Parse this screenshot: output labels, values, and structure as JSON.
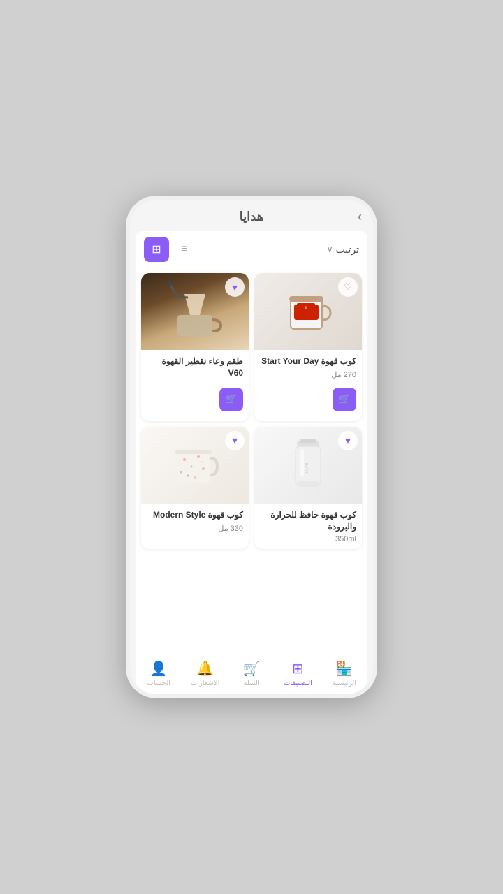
{
  "header": {
    "title": "هدايا",
    "arrow_label": "›"
  },
  "filter": {
    "sort_label": "ترتيب",
    "sort_chevron": "∨",
    "view_grid_active": true
  },
  "products": [
    {
      "id": 1,
      "name": "طقم وعاء تقطير القهوة V60",
      "volume": "",
      "favorited": true,
      "has_cart": true,
      "image_type": "coffee-drip"
    },
    {
      "id": 2,
      "name": "كوب قهوة Start Your Day",
      "volume": "270 مل",
      "favorited": false,
      "has_cart": true,
      "image_type": "coffee-mug"
    },
    {
      "id": 3,
      "name": "كوب قهوة Modern Style",
      "volume": "330 مل",
      "favorited": true,
      "has_cart": false,
      "image_type": "speckled-mug"
    },
    {
      "id": 4,
      "name": "كوب قهوة حافظ للحرارة والبرودة",
      "volume": "350ml",
      "favorited": true,
      "has_cart": false,
      "image_type": "tumbler"
    }
  ],
  "bottom_nav": [
    {
      "id": "home",
      "label": "الرئيسية",
      "icon": "🏪",
      "active": false
    },
    {
      "id": "categories",
      "label": "التصنيفات",
      "icon": "⊞",
      "active": true
    },
    {
      "id": "cart",
      "label": "السلة",
      "icon": "🛒",
      "active": false
    },
    {
      "id": "notify",
      "label": "الاشعارات",
      "icon": "🔔",
      "active": false
    },
    {
      "id": "account",
      "label": "الحساب",
      "icon": "👤",
      "active": false
    }
  ]
}
